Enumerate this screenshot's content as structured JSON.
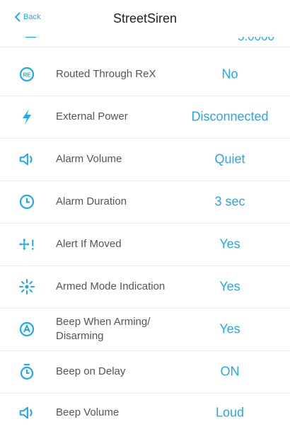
{
  "header": {
    "back_label": "Back",
    "title": "StreetSiren"
  },
  "partial_row": {
    "value": "5.0000"
  },
  "accent_color": "#1ea9f0",
  "rows": [
    {
      "icon": "rex-icon",
      "label": "Routed Through ReX",
      "value": "No"
    },
    {
      "icon": "lightning-icon",
      "label": "External Power",
      "value": "Disconnected"
    },
    {
      "icon": "speaker-icon",
      "label": "Alarm Volume",
      "value": "Quiet"
    },
    {
      "icon": "clock-icon",
      "label": "Alarm Duration",
      "value": "3 sec"
    },
    {
      "icon": "move-alert-icon",
      "label": "Alert If Moved",
      "value": "Yes"
    },
    {
      "icon": "blink-icon",
      "label": "Armed Mode Indication",
      "value": "Yes"
    },
    {
      "icon": "arm-icon",
      "label": "Beep When Arming/ Disarming",
      "value": "Yes"
    },
    {
      "icon": "timer-icon",
      "label": "Beep on Delay",
      "value": "ON"
    },
    {
      "icon": "speaker-icon",
      "label": "Beep Volume",
      "value": "Loud"
    }
  ]
}
